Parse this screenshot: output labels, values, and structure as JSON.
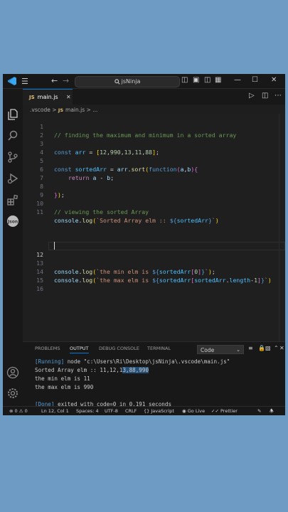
{
  "window": {
    "search_label": "jsNinja",
    "menu_icon": "hamburger-menu-icon"
  },
  "tab": {
    "badge": "JS",
    "filename": "main.js"
  },
  "breadcrumb": {
    "folder": ".vscode",
    "sep": ">",
    "badge": "JS",
    "file": "main.js",
    "sep2": ">",
    "more": "..."
  },
  "editor": {
    "lines": [
      {
        "n": "1"
      },
      {
        "n": "2"
      },
      {
        "n": "3"
      },
      {
        "n": "4"
      },
      {
        "n": "5"
      },
      {
        "n": "6"
      },
      {
        "n": "7"
      },
      {
        "n": "8"
      },
      {
        "n": "9"
      },
      {
        "n": "10"
      },
      {
        "n": "11"
      },
      {
        "n": "12"
      },
      {
        "n": "13"
      },
      {
        "n": "14"
      },
      {
        "n": "15"
      },
      {
        "n": "16"
      }
    ],
    "t": {
      "l1": "// finding the maximum and minimum in a sorted array",
      "l3_kw": "const",
      "l3_var": "arr",
      "l3_eq": " = ",
      "l3_arr_open": "[",
      "l3_n1": "12",
      "l3_n2": "990",
      "l3_n3": "13",
      "l3_n4": "11",
      "l3_n5": "88",
      "l3_arr_close": "]",
      "l3_end": ";",
      "l3_comma": ",",
      "l5_kw": "const",
      "l5_var": "sortedArr",
      "l5_eq": " = ",
      "l5_obj": "arr",
      "l5_dot": ".",
      "l5_fn": "sort",
      "l5_p1": "(",
      "l5_kwfn": "function",
      "l5_p2": "(",
      "l5_a": "a",
      "l5_comma": ",",
      "l5_b": "b",
      "l5_p3": ")",
      "l5_brace": "{",
      "l6_ret": "return",
      "l6_a": "a",
      "l6_minus": " - ",
      "l6_b": "b",
      "l6_end": ";",
      "l8_brace": "}",
      "l8_paren": ")",
      "l8_end": ";",
      "l10": "// viewing the sorted Array",
      "l11_obj": "console",
      "l11_dot": ".",
      "l11_fn": "log",
      "l11_p": "(",
      "l11_str": "`Sorted Array elm :: ",
      "l11_ipo": "${",
      "l11_var": "sortedArr",
      "l11_ipc": "}",
      "l11_tick": "`",
      "l11_pc": ")",
      "l13_obj": "console",
      "l13_dot": ".",
      "l13_fn": "log",
      "l13_p": "(",
      "l13_str": "`the min elm is ",
      "l13_ipo": "${",
      "l13_var": "sortedArr",
      "l13_b1": "[",
      "l13_num": "0",
      "l13_b2": "]",
      "l13_ipc": "}",
      "l13_tick": "`",
      "l13_pc": ")",
      "l13_end": ";",
      "l14_obj": "console",
      "l14_dot": ".",
      "l14_fn": "log",
      "l14_p": "(",
      "l14_str": "`the max elm is ",
      "l14_ipo": "${",
      "l14_var": "sortedArr",
      "l14_b1": "[",
      "l14_var2": "sortedArr",
      "l14_dot2": ".",
      "l14_len": "length",
      "l14_minus": "-",
      "l14_num": "1",
      "l14_b2": "]",
      "l14_ipc": "}",
      "l14_tick": "`",
      "l14_pc": ")"
    }
  },
  "panel": {
    "tabs": [
      "PROBLEMS",
      "OUTPUT",
      "DEBUG CONSOLE",
      "TERMINAL"
    ],
    "select_value": "Code",
    "output": {
      "running_tag": "[Running]",
      "running_cmd": " node \"c:\\Users\\Ri\\Desktop\\jsNinja\\.vscode\\main.js\"",
      "sorted_pre": "Sorted Array elm :: 11,12,1",
      "sorted_sel": "3,88,990",
      "min": "the min elm is 11",
      "max": "the max elm is 990",
      "done_tag": "[Done]",
      "done_msg": " exited with code=0 in 0.191 seconds"
    }
  },
  "status": {
    "errors": "0",
    "warnings": "0",
    "position": "Ln 12, Col 1",
    "spaces": "Spaces: 4",
    "encoding": "UTF-8",
    "eol": "CRLF",
    "language": "JavaScript",
    "golive": "Go Live",
    "prettier": "Prettier"
  },
  "colors": {
    "accent": "#0078d4",
    "background": "#6d9bc4",
    "editor_bg": "#1f1f1f"
  }
}
